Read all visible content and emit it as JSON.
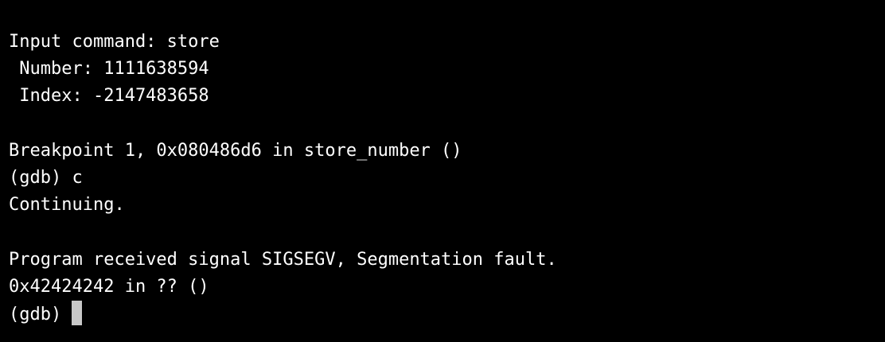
{
  "colors": {
    "background": "#000000",
    "text": "#ffffff",
    "cursor": "#c8c8c8"
  },
  "terminal": {
    "lines": [
      "Input command: store",
      " Number: 1111638594",
      " Index: -2147483658",
      "",
      "Breakpoint 1, 0x080486d6 in store_number ()",
      "(gdb) c",
      "Continuing.",
      "",
      "Program received signal SIGSEGV, Segmentation fault.",
      "0x42424242 in ?? ()"
    ],
    "prompt": "(gdb)"
  }
}
